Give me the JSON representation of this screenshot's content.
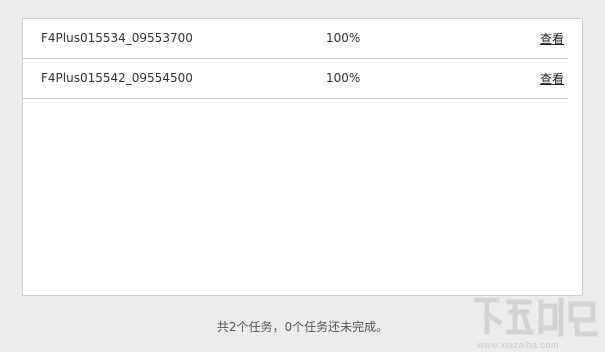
{
  "tasks": [
    {
      "name": "F4Plus015534_09553700",
      "progress": "100%",
      "action": "查看"
    },
    {
      "name": "F4Plus015542_09554500",
      "progress": "100%",
      "action": "查看"
    }
  ],
  "summary": "共2个任务，0个任务还未完成。",
  "watermark": {
    "text": "www.xiazaiba.com",
    "color": "#c8c8c8"
  }
}
